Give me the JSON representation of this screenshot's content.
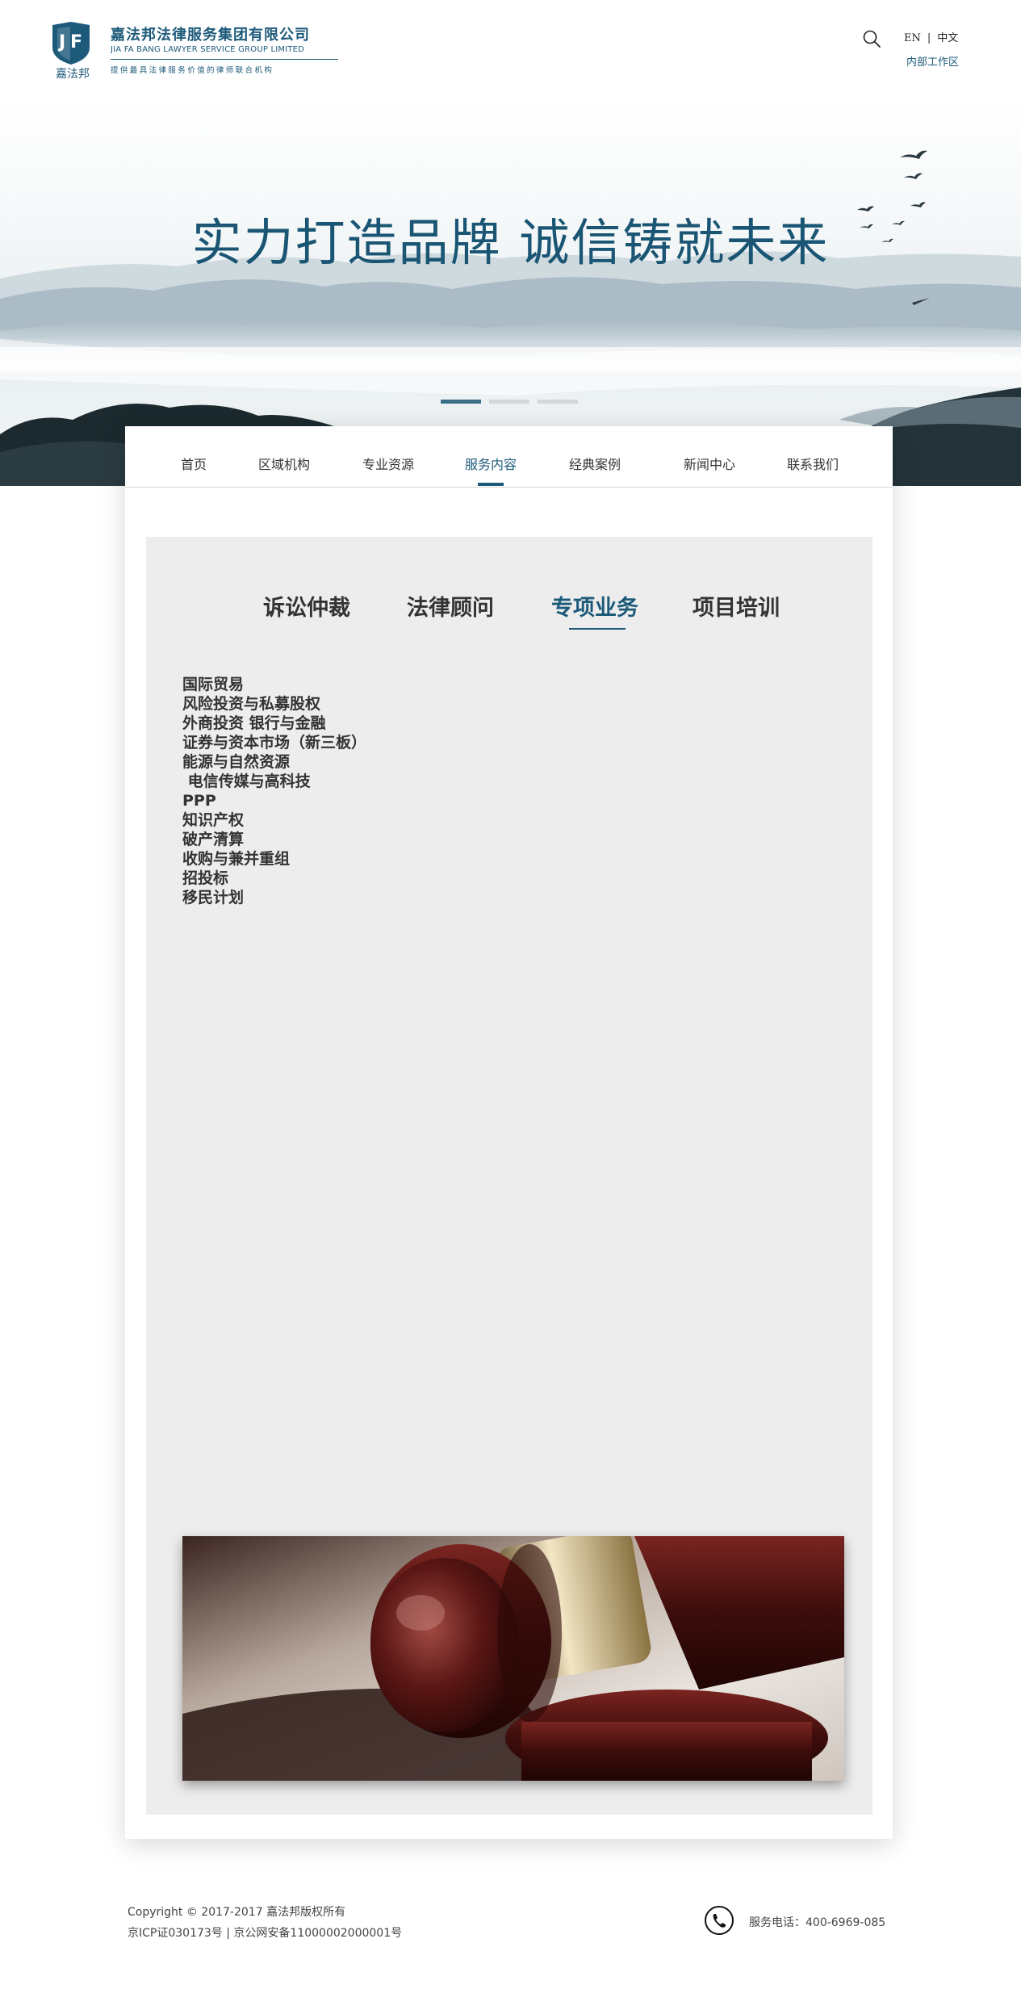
{
  "header": {
    "logo_small_cn": "嘉法邦",
    "company_name": "嘉法邦法律服务集团有限公司",
    "company_en": "JIA FA BANG LAWYER SERVICE GROUP LIMITED",
    "slogan": "提供最具法律服务价值的律师联合机构",
    "lang_en": "EN",
    "lang_separator": "|",
    "lang_cn": "中文",
    "internal_link": "内部工作区",
    "brand_color": "#1d5a7a"
  },
  "banner": {
    "title": "实力打造品牌  诚信铸就未来",
    "slides": 3,
    "active_slide": 1
  },
  "nav": {
    "items": [
      {
        "label": "首页"
      },
      {
        "label": "区域机构"
      },
      {
        "label": "专业资源"
      },
      {
        "label": "服务内容"
      },
      {
        "label": "经典案例"
      },
      {
        "label": "新闻中心"
      },
      {
        "label": "联系我们"
      }
    ],
    "active_index": 3
  },
  "tabs": {
    "items": [
      {
        "label": "诉讼仲裁"
      },
      {
        "label": "法律顾问"
      },
      {
        "label": "专项业务"
      },
      {
        "label": "项目培训"
      }
    ],
    "active_index": 2
  },
  "services": [
    "国际贸易",
    "风险投资与私募股权",
    "外商投资 银行与金融",
    "证券与资本市场（新三板）",
    "能源与自然资源",
    " 电信传媒与高科技",
    "PPP",
    "知识产权",
    "破产清算",
    "收购与兼并重组",
    "招投标",
    "移民计划"
  ],
  "footer": {
    "copyright": "Copyright © 2017-2017 嘉法邦版权所有",
    "icp": "京ICP证030173号 | 京公网安备11000002000001号",
    "phone": "服务电话：400-6969-085"
  }
}
